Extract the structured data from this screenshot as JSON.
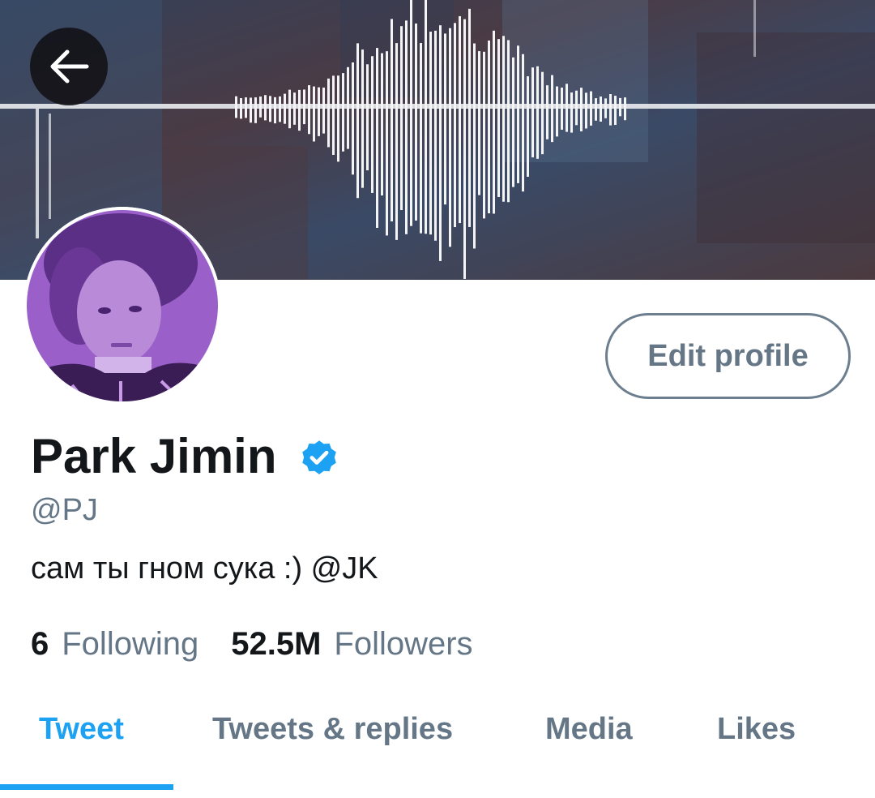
{
  "profile": {
    "display_name": "Park Jimin",
    "handle": "@PJ",
    "bio": "сам ты гном сука :) @JK",
    "verified": true
  },
  "actions": {
    "back_icon": "arrow-left-icon",
    "edit_profile_label": "Edit profile"
  },
  "stats": {
    "following_count": "6",
    "following_label": "Following",
    "followers_count": "52.5M",
    "followers_label": "Followers"
  },
  "tabs": [
    {
      "label": "Tweet",
      "active": true
    },
    {
      "label": "Tweets & replies",
      "active": false
    },
    {
      "label": "Media",
      "active": false
    },
    {
      "label": "Likes",
      "active": false
    }
  ],
  "colors": {
    "accent": "#1da1f2",
    "secondary_text": "#657786",
    "primary_text": "#14171a",
    "avatar_tint": "#8a4fbf"
  }
}
